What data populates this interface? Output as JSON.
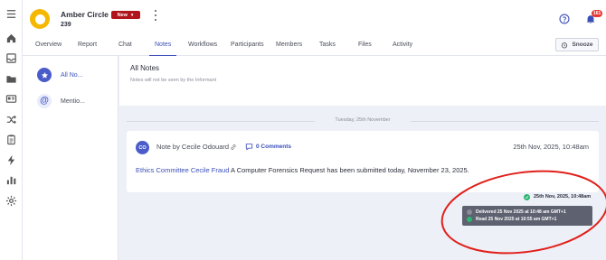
{
  "header": {
    "case_title": "Amber Circle",
    "case_id": "239",
    "status_label": "New",
    "notification_count": "161",
    "snooze_label": "Snooze"
  },
  "tabs": [
    {
      "label": "Overview"
    },
    {
      "label": "Report"
    },
    {
      "label": "Chat"
    },
    {
      "label": "Notes",
      "active": true
    },
    {
      "label": "Workflows"
    },
    {
      "label": "Participants"
    },
    {
      "label": "Members"
    },
    {
      "label": "Tasks"
    },
    {
      "label": "Files"
    },
    {
      "label": "Activity"
    }
  ],
  "rail_icons": [
    "menu-icon",
    "home-icon",
    "inbox-icon",
    "folder-icon",
    "id-card-icon",
    "shuffle-icon",
    "clipboard-icon",
    "bolt-icon",
    "bar-chart-icon",
    "settings-icon"
  ],
  "notes_sidebar": {
    "items": [
      {
        "label": "All No...",
        "icon": "star-icon",
        "active": true
      },
      {
        "label": "Mentio...",
        "icon": "at-icon",
        "active": false
      }
    ]
  },
  "main": {
    "title": "All Notes",
    "subtitle": "Notes will not be seen by the Informant",
    "date_divider": "Tuesday, 25th November"
  },
  "note": {
    "avatar_initials": "CO",
    "author_line": "Note by Cecile Odouard",
    "comments_label": "0 Comments",
    "timestamp": "25th Nov, 2025, 10:48am",
    "mention": "Ethics Committee Cecile Fraud",
    "body": " A Computer Forensics Request has been submitted today, November 23, 2025."
  },
  "delivery": {
    "time": "25th Nov, 2025, 10:48am",
    "delivered": "Delivered 25 Nov 2025 at 10:48 am GMT+1",
    "read": "Read 25 Nov 2025 at 10:55 am GMT+1"
  },
  "colors": {
    "accent": "#3b4fb8",
    "badge_red": "#b0141c",
    "avatar_yellow": "#f5b800",
    "success": "#2bb673",
    "annotation_red": "#e0201b"
  }
}
